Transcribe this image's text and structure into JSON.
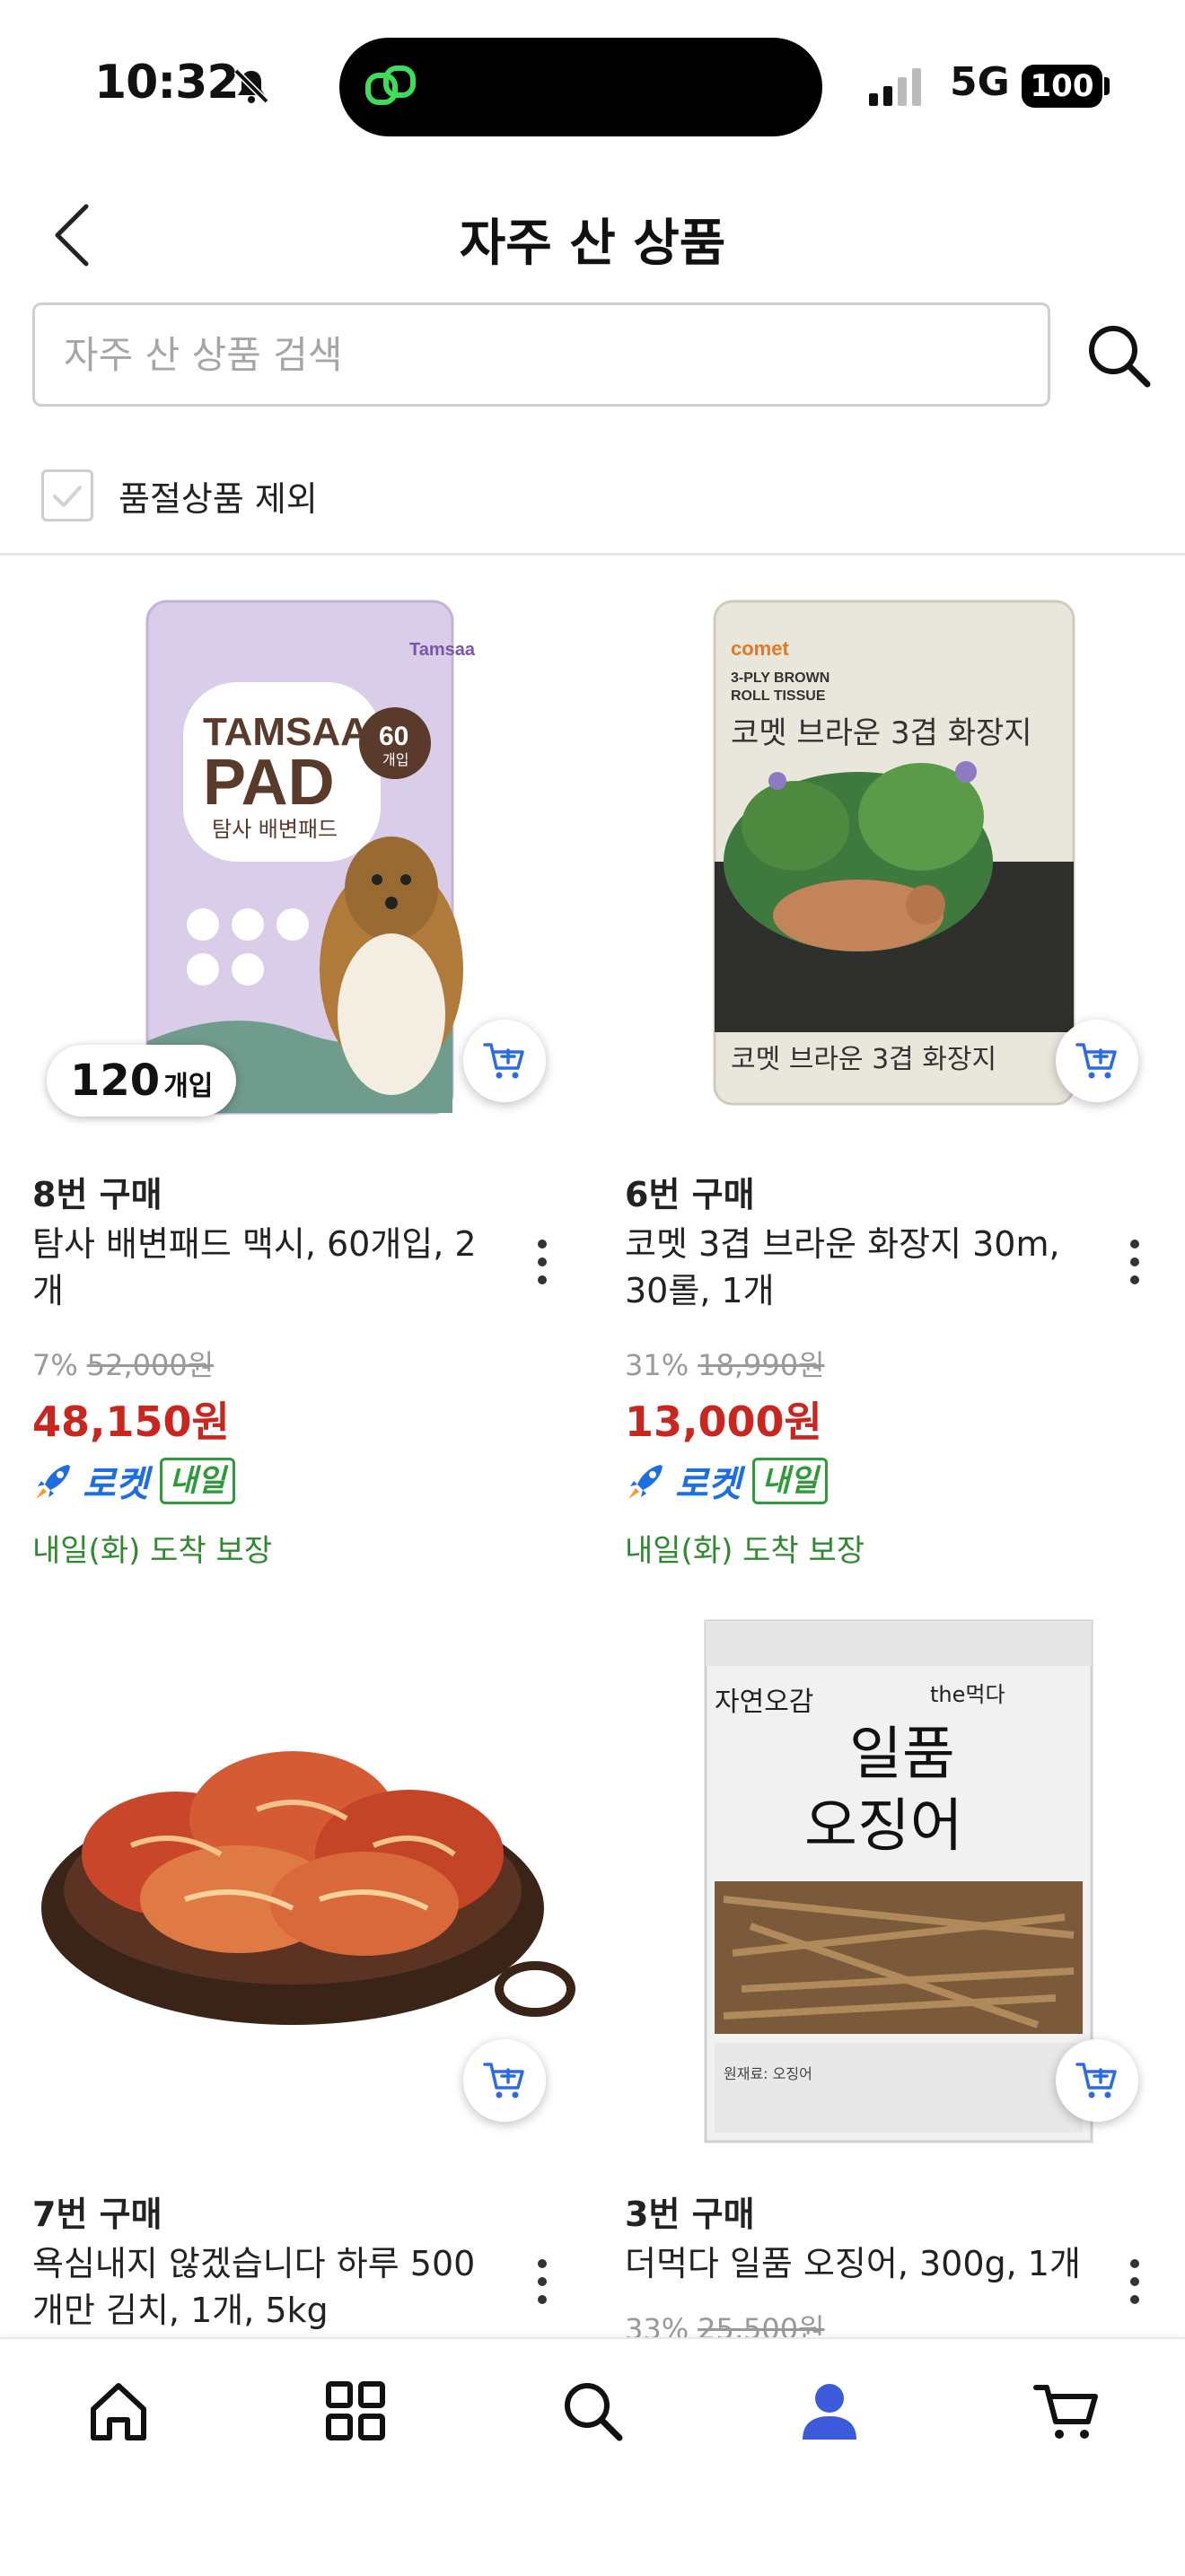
{
  "status_bar": {
    "time": "10:32",
    "network": "5G",
    "battery": "100"
  },
  "header": {
    "title": "자주 산 상품"
  },
  "search": {
    "placeholder": "자주 산 상품 검색"
  },
  "filter": {
    "exclude_sold_out_label": "품절상품 제외",
    "checked": false
  },
  "colors": {
    "sale_price": "#c8261f",
    "rocket_blue": "#1d6ee0",
    "arrival_green": "#2f8a2f",
    "nav_active": "#3b5bdb"
  },
  "products": [
    {
      "image_label": "TAMSAA PAD 60개입",
      "quantity_badge": {
        "number": "120",
        "unit": "개입"
      },
      "buy_count": "8번 구매",
      "name": "탐사 배변패드 맥시, 60개입, 2개",
      "discount": "7%",
      "original_price": "52,000원",
      "sale_price": "48,150원",
      "rocket_label": "로켓",
      "rocket_badge": "내일",
      "arrival": "내일(화) 도착 보장"
    },
    {
      "image_label": "코멧 브라운 3겹 화장지",
      "buy_count": "6번 구매",
      "name": "코멧 3겹 브라운 화장지 30m, 30롤, 1개",
      "discount": "31%",
      "original_price": "18,990원",
      "sale_price": "13,000원",
      "rocket_label": "로켓",
      "rocket_badge": "내일",
      "arrival": "내일(화) 도착 보장"
    },
    {
      "image_label": "kimchi",
      "buy_count": "7번 구매",
      "name": "욕심내지 않겠습니다 하루 500개만 김치, 1개, 5kg"
    },
    {
      "image_label": "일품 오징어",
      "buy_count": "3번 구매",
      "name": "더먹다 일품 오징어, 300g, 1개",
      "discount": "33%",
      "original_price": "25,500원"
    }
  ],
  "bottom_nav": [
    {
      "name": "home-icon",
      "active": false
    },
    {
      "name": "category-icon",
      "active": false
    },
    {
      "name": "search-icon",
      "active": false
    },
    {
      "name": "my-coupang-icon",
      "active": true
    },
    {
      "name": "cart-icon",
      "active": false
    }
  ]
}
